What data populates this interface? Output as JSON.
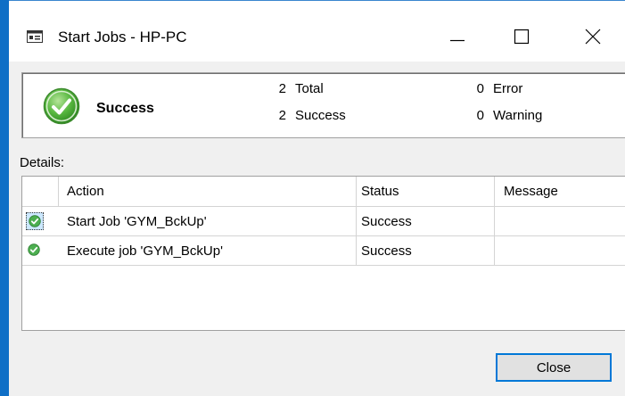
{
  "window": {
    "title": "Start Jobs - HP-PC"
  },
  "summary": {
    "status": "Success",
    "total_count": "2",
    "total_label": "Total",
    "success_count": "2",
    "success_label": "Success",
    "error_count": "0",
    "error_label": "Error",
    "warning_count": "0",
    "warning_label": "Warning"
  },
  "details": {
    "label": "Details:",
    "columns": [
      "Action",
      "Status",
      "Message"
    ],
    "rows": [
      {
        "action": "Start Job 'GYM_BckUp'",
        "status": "Success",
        "message": ""
      },
      {
        "action": "Execute job 'GYM_BckUp'",
        "status": "Success",
        "message": ""
      }
    ]
  },
  "buttons": {
    "close_label": "Close"
  },
  "colors": {
    "accent": "#0078d7",
    "success_green": "#4caf50",
    "frame_blue": "#0f6fc6"
  },
  "icons": {
    "app": "window-app-icon",
    "status": "success-check-icon"
  }
}
